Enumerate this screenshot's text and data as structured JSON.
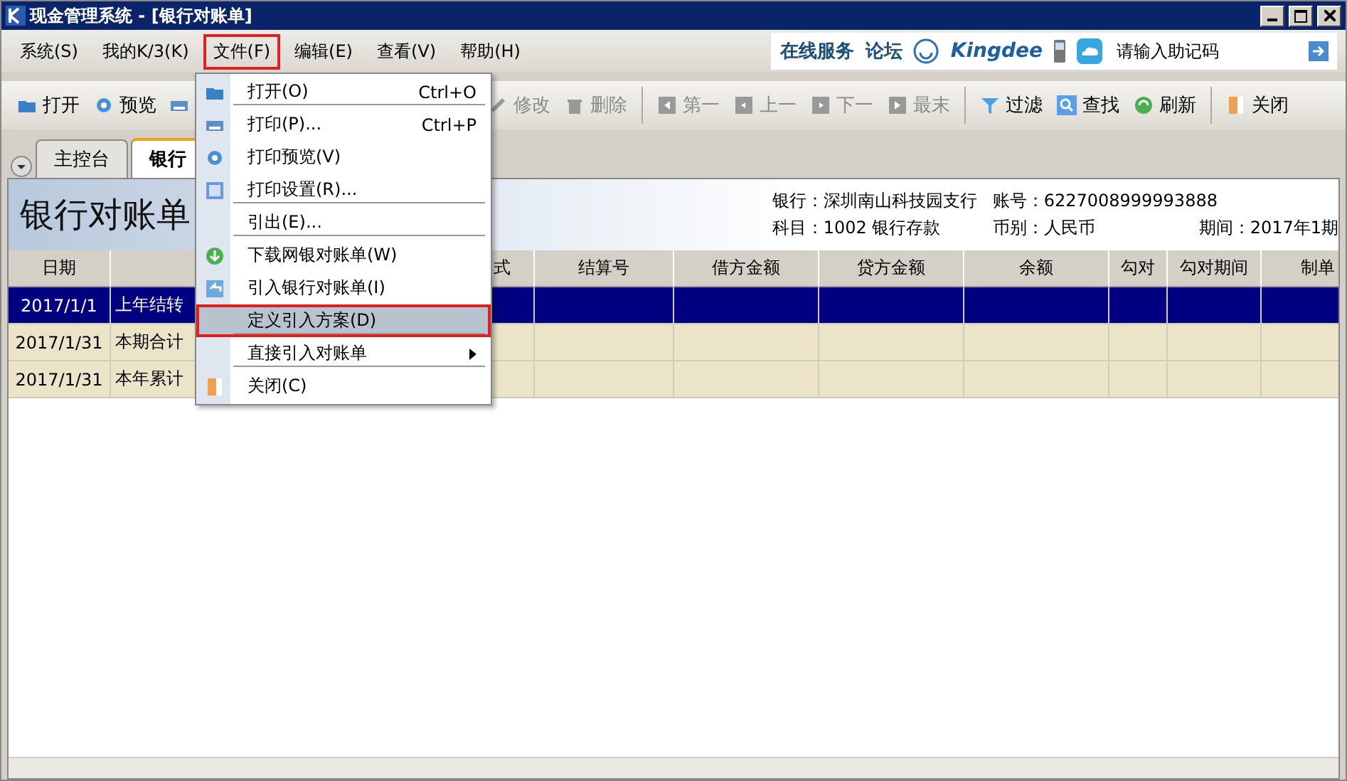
{
  "window": {
    "title": "现金管理系统 - [银行对账单]"
  },
  "menu_bar": [
    {
      "label": "系统(S)",
      "selected": false
    },
    {
      "label": "我的K/3(K)",
      "selected": false
    },
    {
      "label": "文件(F)",
      "selected": true
    },
    {
      "label": "编辑(E)",
      "selected": false
    },
    {
      "label": "查看(V)",
      "selected": false
    },
    {
      "label": "帮助(H)",
      "selected": false
    }
  ],
  "service_links": [
    "在线服务",
    "论坛"
  ],
  "brand": "Kingdee",
  "search": {
    "placeholder": "请输入助记码"
  },
  "toolbar": [
    [
      {
        "label": "打开",
        "disabled": false
      },
      {
        "label": "预览",
        "disabled": false
      }
    ],
    [
      {
        "label": "修改",
        "disabled": true
      },
      {
        "label": "删除",
        "disabled": true
      }
    ],
    [
      {
        "label": "第一",
        "disabled": true
      },
      {
        "label": "上一",
        "disabled": true
      },
      {
        "label": "下一",
        "disabled": true
      },
      {
        "label": "最末",
        "disabled": true
      }
    ],
    [
      {
        "label": "过滤",
        "disabled": false
      },
      {
        "label": "查找",
        "disabled": false
      },
      {
        "label": "刷新",
        "disabled": false
      }
    ],
    [
      {
        "label": "关闭",
        "disabled": false
      }
    ]
  ],
  "tabs": [
    {
      "label": "主控台",
      "selected": false
    },
    {
      "label": "银行",
      "selected": true
    }
  ],
  "report": {
    "title": "银行对账单",
    "info": [
      [
        "银行：深圳南山科技园支行",
        "账号：6227008999993888"
      ],
      [
        "科目：1002 银行存款",
        "币别：人民币",
        "期间：2017年1期"
      ]
    ]
  },
  "table": {
    "columns": [
      "日期",
      null,
      "式",
      "结算号",
      "借方金额",
      "贷方金额",
      "余额",
      "勾对",
      "勾对期间",
      "制单"
    ],
    "rows": [
      {
        "cells": [
          "2017/1/1",
          "上年结转"
        ],
        "selected": true
      },
      {
        "cells": [
          "2017/1/31",
          "本期合计"
        ],
        "selected": false
      },
      {
        "cells": [
          "2017/1/31",
          "本年累计"
        ],
        "selected": false
      }
    ]
  },
  "file_menu": [
    {
      "label": "打开(O)",
      "shortcut": "Ctrl+O",
      "selected": false,
      "separator_after": true,
      "submenu": false
    },
    {
      "label": "打印(P)...",
      "shortcut": "Ctrl+P",
      "selected": false,
      "separator_after": false,
      "submenu": false
    },
    {
      "label": "打印预览(V)",
      "selected": false,
      "separator_after": false,
      "submenu": false
    },
    {
      "label": "打印设置(R)...",
      "selected": false,
      "separator_after": true,
      "submenu": false
    },
    {
      "label": "引出(E)...",
      "selected": false,
      "separator_after": true,
      "submenu": false
    },
    {
      "label": "下载网银对账单(W)",
      "selected": false,
      "separator_after": false,
      "submenu": false
    },
    {
      "label": "引入银行对账单(I)",
      "selected": false,
      "separator_after": false,
      "submenu": false
    },
    {
      "label": "定义引入方案(D)",
      "selected": true,
      "separator_after": true,
      "submenu": false
    },
    {
      "label": "直接引入对账单",
      "selected": false,
      "separator_after": true,
      "submenu": true
    },
    {
      "label": "关闭(C)",
      "selected": false,
      "separator_after": false,
      "submenu": false
    }
  ]
}
